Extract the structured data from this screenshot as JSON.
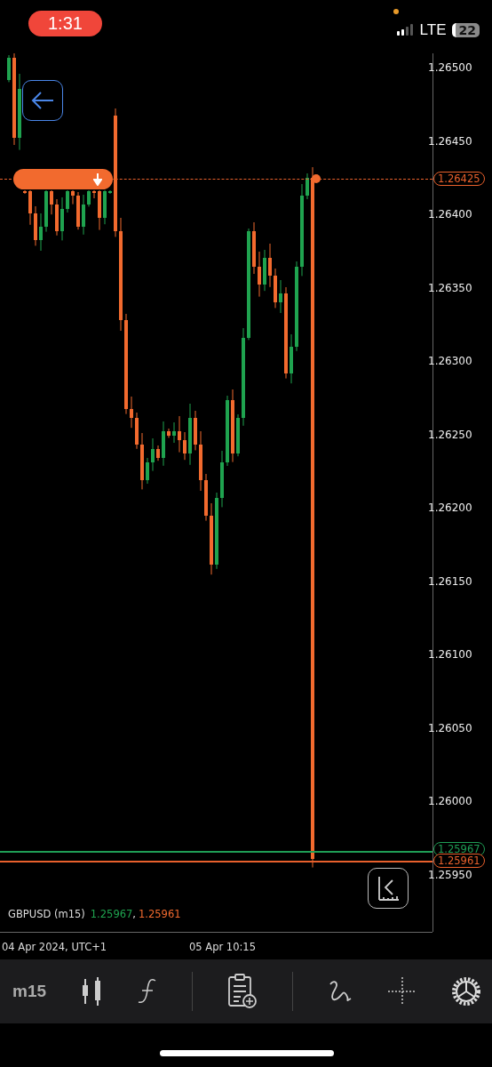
{
  "status_bar": {
    "time": "1:31",
    "network": "LTE",
    "battery": "22"
  },
  "chart": {
    "price_axis": [
      "1.26500",
      "1.26450",
      "1.26400",
      "1.26350",
      "1.26300",
      "1.26250",
      "1.26200",
      "1.26150",
      "1.26100",
      "1.26050",
      "1.26000",
      "1.25950"
    ],
    "price_lines": [
      {
        "label": "1.26425",
        "color": "#e8602c",
        "kind": "dashed"
      },
      {
        "label": "1.25967",
        "color": "#1f9d55",
        "kind": "solid"
      },
      {
        "label": "1.25961",
        "color": "#e8602c",
        "kind": "solid"
      }
    ],
    "symbol": "GBPUSD (m15)",
    "bid": "1.25967",
    "separator": ",",
    "ask": "1.25961",
    "time_axis": [
      "04 Apr 2024, UTC+1",
      "05 Apr 10:15"
    ]
  },
  "toolbar": {
    "timeframe": "m15"
  }
}
